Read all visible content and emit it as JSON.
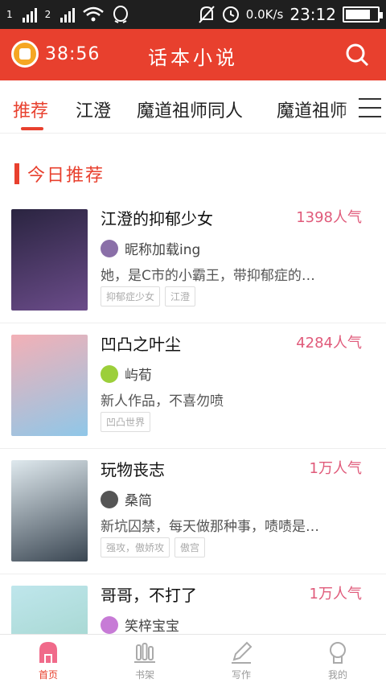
{
  "status_bar": {
    "sim1": "1",
    "sim2": "2",
    "speed": "0.0K/s",
    "time": "23:12",
    "battery_level": 0.8
  },
  "header": {
    "timer": "38:56",
    "title": "话本小说"
  },
  "tabs": [
    "推荐",
    "江澄",
    "魔道祖师同人",
    "魔道祖师"
  ],
  "section": {
    "title": "今日推荐"
  },
  "books": [
    {
      "title": "江澄的抑郁少女",
      "popularity": "1398人气",
      "author": "昵称加载ing",
      "desc": "她，是C市的小霸王，带抑郁症的…",
      "tags": [
        "抑郁症少女",
        "江澄"
      ],
      "cover_colors": [
        "#2a2440",
        "#6b4c8a"
      ],
      "avatar_color": "#8a6fa8"
    },
    {
      "title": "凹凸之叶尘",
      "popularity": "4284人气",
      "author": "屿荀",
      "desc": "新人作品，不喜勿喷",
      "tags": [
        "凹凸世界"
      ],
      "cover_colors": [
        "#f3b0b6",
        "#8fc7e8"
      ],
      "avatar_color": "#9ccf3a"
    },
    {
      "title": "玩物丧志",
      "popularity": "1万人气",
      "author": "桑简",
      "desc": "新坑囚禁，每天做那种事，啧啧是…",
      "tags": [
        "强攻，傲娇攻",
        "傲宫"
      ],
      "cover_colors": [
        "#dfe9ee",
        "#3a4652"
      ],
      "avatar_color": "#555"
    },
    {
      "title": "哥哥，不打了",
      "popularity": "1万人气",
      "author": "笑梓宝宝",
      "desc": "",
      "tags": [],
      "cover_colors": [
        "#bfe6ec",
        "#9ad0c4"
      ],
      "avatar_color": "#c77bd6"
    }
  ],
  "bottom_nav": [
    {
      "label": "首页",
      "icon": "home-icon",
      "active": true
    },
    {
      "label": "书架",
      "icon": "bookshelf-icon",
      "active": false
    },
    {
      "label": "写作",
      "icon": "pencil-icon",
      "active": false
    },
    {
      "label": "我的",
      "icon": "profile-icon",
      "active": false
    }
  ],
  "colors": {
    "accent": "#e8402e",
    "popularity": "#e05a7a"
  }
}
